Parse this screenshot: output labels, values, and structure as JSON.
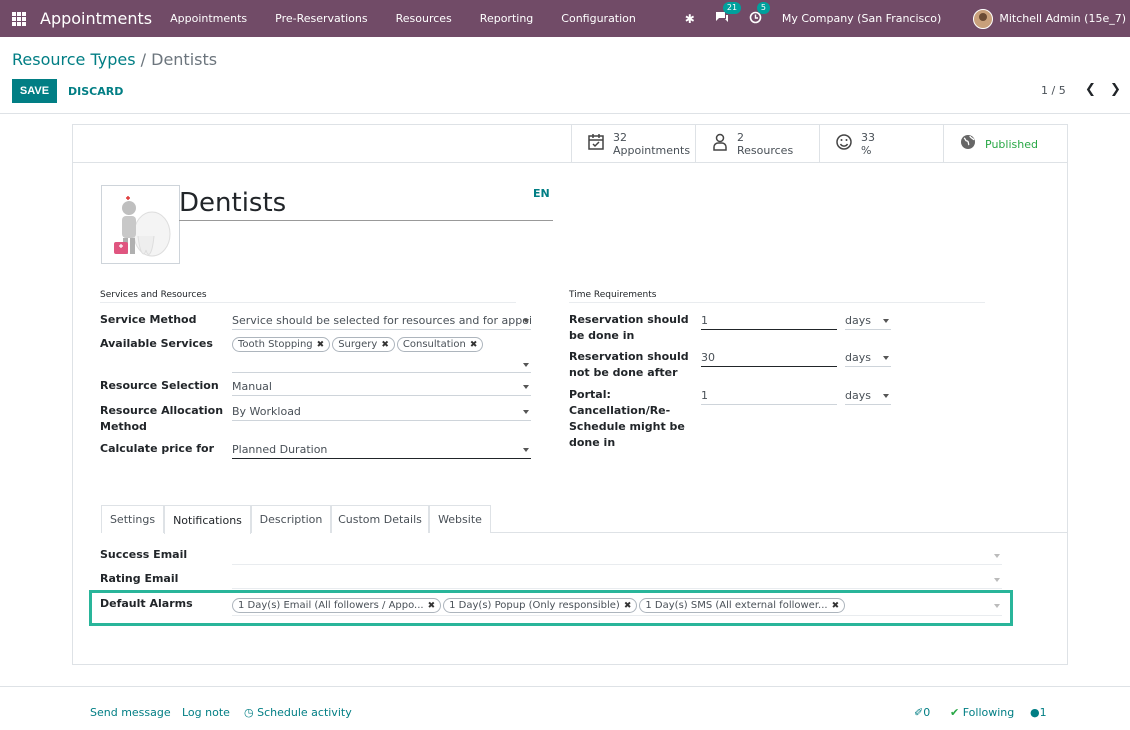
{
  "navbar": {
    "brand": "Appointments",
    "menu": [
      "Appointments",
      "Pre-Reservations",
      "Resources",
      "Reporting",
      "Configuration"
    ],
    "messages_count": "21",
    "activities_count": "5",
    "company": "My Company (San Francisco)",
    "user": "Mitchell Admin (15e_7)"
  },
  "breadcrumb": {
    "parent": "Resource Types",
    "separator": "/",
    "current": "Dentists"
  },
  "controls": {
    "save": "SAVE",
    "discard": "DISCARD",
    "pager": "1 / 5"
  },
  "stat_buttons": {
    "appointments": {
      "value": "32",
      "label": "Appointments"
    },
    "resources": {
      "value": "2",
      "label": "Resources"
    },
    "rating": {
      "value": "33",
      "label": "%"
    },
    "published": {
      "label": "Published"
    }
  },
  "record": {
    "name": "Dentists",
    "lang": "EN"
  },
  "services": {
    "section_title": "Services and Resources",
    "service_method_label": "Service Method",
    "service_method_value": "Service should be selected for resources and for appointment",
    "available_services_label": "Available Services",
    "available_services": [
      "Tooth Stopping",
      "Surgery",
      "Consultation"
    ],
    "resource_selection_label": "Resource Selection",
    "resource_selection_value": "Manual",
    "resource_allocation_label": "Resource Allocation Method",
    "resource_allocation_value": "By Workload",
    "calculate_price_label": "Calculate price for",
    "calculate_price_value": "Planned Duration"
  },
  "time": {
    "section_title": "Time Requirements",
    "reservation_before_label": "Reservation should be done in",
    "reservation_before_value": "1",
    "reservation_before_unit": "days",
    "reservation_after_label": "Reservation should not be done after",
    "reservation_after_value": "30",
    "reservation_after_unit": "days",
    "portal_label": "Portal: Cancellation/Re-Schedule might be done in",
    "portal_value": "1",
    "portal_unit": "days"
  },
  "tabs": [
    "Settings",
    "Notifications",
    "Description",
    "Custom Details",
    "Website"
  ],
  "notifications": {
    "success_email_label": "Success Email",
    "rating_email_label": "Rating Email",
    "default_alarms_label": "Default Alarms",
    "alarms": [
      "1 Day(s) Email (All followers / Appo...",
      "1 Day(s) Popup (Only responsible)",
      "1 Day(s) SMS (All external follower..."
    ]
  },
  "chatter": {
    "send_message": "Send message",
    "log_note": "Log note",
    "schedule_activity": "Schedule activity",
    "attachments": "0",
    "following": "Following",
    "followers": "1"
  }
}
